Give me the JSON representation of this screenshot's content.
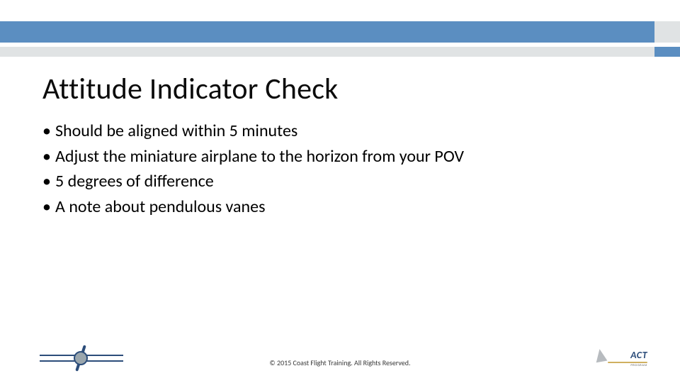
{
  "title": "Attitude Indicator Check",
  "bullets": [
    "Should be aligned within 5 minutes",
    "Adjust the miniature airplane to the horizon from your POV",
    "5 degrees of difference",
    "A note about pendulous vanes"
  ],
  "footer": "© 2015 Coast Flight Training. All Rights Reserved.",
  "logo_left_alt": "Coast Flight Training",
  "logo_right_text": "ACT",
  "logo_right_sub": "PROGRAM",
  "colors": {
    "blue_bar": "#5b8ec1",
    "gray_bar": "#e0e3e4",
    "logo_navy": "#2c4d7a"
  }
}
